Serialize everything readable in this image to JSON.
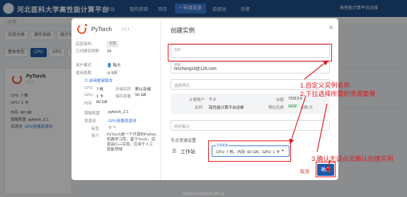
{
  "header": {
    "app_title": "河北医科大学高性能计算平台",
    "nav": [
      "工作台",
      "我的资源",
      "项目"
    ],
    "create_button": "+ 申请资源",
    "nav_right": [
      "资源池",
      "告警"
    ],
    "user": "高性能计算平台运维"
  },
  "subbar": {
    "breadcrumb": "/ 应用"
  },
  "background": {
    "filters_row1": [
      "应用分类",
      "操作系统",
      "统计分"
    ],
    "filters_row2": [
      "基本类型",
      "CPU",
      "GPU",
      "显卡"
    ],
    "card": {
      "title": "PyTorch",
      "version": "2.1.1",
      "rows": [
        {
          "k": "CPU",
          "v": "7 核"
        },
        {
          "k": "GPU",
          "v": "1 卡"
        },
        {
          "k": "内存",
          "v": "60 GB"
        },
        {
          "k": "镜像配置",
          "v": "pytorch_2.1"
        },
        {
          "k": "资源池",
          "v": "GPU容器资源池"
        }
      ]
    }
  },
  "modal": {
    "left": {
      "title": "PyTorch",
      "version": "2.1.1",
      "framework_label": "底层架构",
      "framework_tag": "容器",
      "created_label": "已创建实例数",
      "created_value": "24",
      "owner_label": "用户模式",
      "owner_value": "独占",
      "period_label": "使用周期",
      "period_value": "5天",
      "collapse_link": "⊙ 启用框架版本",
      "specs": [
        {
          "k": "CPU",
          "v": "7 核",
          "k2": "存储名称",
          "v2": "默认存储"
        },
        {
          "k": "GPU",
          "v": "1 卡",
          "k2": "储存容量",
          "v2": "50 GB"
        },
        {
          "k": "内存",
          "v": "60 GB",
          "k2": "",
          "v2": ""
        }
      ],
      "image_label": "镜像配置",
      "image_value": "pytorch_2.1",
      "pool_label": "资源池",
      "pool_value": "GPU容器资源池",
      "tags_label": "标签",
      "tags_icons": "⚙  ✎",
      "intro_label": "简介",
      "intro": "PyTorch是一个开源的Python机器学习库，基于Torch，底层由C++实现，应用于人工智能领域"
    },
    "right": {
      "title": "创建实例",
      "name_label": "名称 *",
      "email_label": "邮箱 *",
      "email_value": "limzhang18@126.com",
      "project_placeholder": "选择项目",
      "account": {
        "k1": "计费账户",
        "v1": "个人",
        "k2": "余额",
        "v2": "73313.6",
        "k3": "名称",
        "v3": "高性能计算平台运维",
        "k4": "预估花费",
        "v4": "1632",
        "unit": "点数/天"
      },
      "remark_placeholder": "用途备注",
      "section": "节点资源设置",
      "workstation_label": "工作站",
      "select_label": "资源套餐",
      "select_value": "CPU: 7 核，内存: 60 GB，GPU: 1 卡",
      "cancel": "取消",
      "confirm": "确定"
    }
  },
  "annotations": [
    "1.自定义实例名称",
    "2.下拉选择所需的资源套餐",
    "3.确认无误点击确认创建实例"
  ],
  "footer": "河北医科大学高性能计算平台",
  "colors": {
    "accent": "#1e5aa8",
    "topbar": "#1e4f8a",
    "annotation": "#e0191f",
    "pytorch": "#ee4c2c"
  }
}
